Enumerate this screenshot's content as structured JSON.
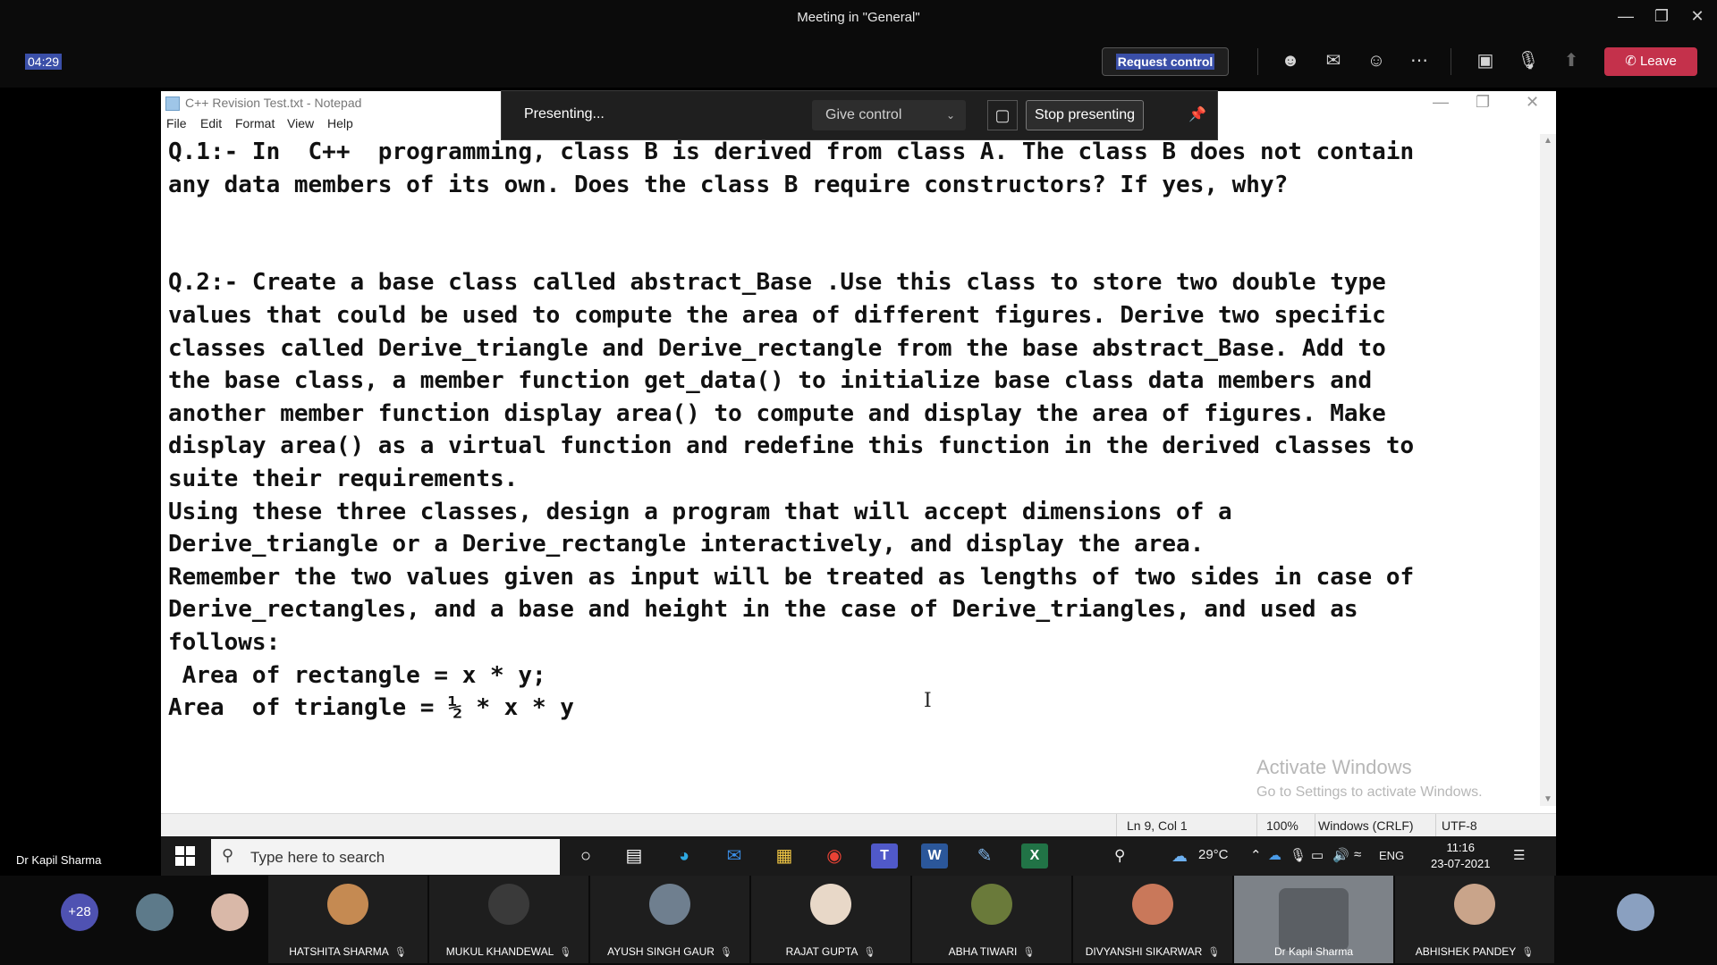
{
  "window": {
    "title": "Meeting in \"General\""
  },
  "toolbar": {
    "timer": "04:29",
    "request_control": "Request control",
    "leave": "Leave",
    "icons": [
      "people-icon",
      "chat-icon",
      "reactions-icon",
      "more-icon",
      "camera-off-icon",
      "mic-off-icon",
      "share-tray-icon"
    ]
  },
  "presenting_bar": {
    "status": "Presenting...",
    "give_control": "Give control",
    "stop_presenting": "Stop presenting"
  },
  "notepad": {
    "title": "C++ Revision Test.txt - Notepad",
    "menu": [
      "File",
      "Edit",
      "Format",
      "View",
      "Help"
    ],
    "text": "Q.1:- In  C++  programming, class B is derived from class A. The class B does not contain\nany data members of its own. Does the class B require constructors? If yes, why?\n\n\nQ.2:- Create a base class called abstract_Base .Use this class to store two double type\nvalues that could be used to compute the area of different figures. Derive two specific\nclasses called Derive_triangle and Derive_rectangle from the base abstract_Base. Add to\nthe base class, a member function get_data() to initialize base class data members and\nanother member function display area() to compute and display the area of figures. Make\ndisplay area() as a virtual function and redefine this function in the derived classes to\nsuite their requirements.\nUsing these three classes, design a program that will accept dimensions of a\nDerive_triangle or a Derive_rectangle interactively, and display the area.\nRemember the two values given as input will be treated as lengths of two sides in case of\nDerive_rectangles, and a base and height in the case of Derive_triangles, and used as\nfollows:\n Area of rectangle = x * y;\nArea  of triangle = ½ * x * y",
    "watermark_line1": "Activate Windows",
    "watermark_line2": "Go to Settings to activate Windows.",
    "status": {
      "position": "Ln 9, Col 1",
      "zoom": "100%",
      "line_ending": "Windows (CRLF)",
      "encoding": "UTF-8"
    }
  },
  "taskbar": {
    "search_placeholder": "Type here to search",
    "weather": "29°C",
    "language": "ENG",
    "time": "11:16",
    "date": "23-07-2021"
  },
  "presenter_name": "Dr Kapil Sharma",
  "participants": {
    "more_count": "+28",
    "tiles": [
      {
        "name": "HATSHITA SHARMA",
        "color": "#c58a52"
      },
      {
        "name": "MUKUL KHANDEWAL",
        "color": "#3a3a3a"
      },
      {
        "name": "AYUSH SINGH GAUR",
        "color": "#6f7f8f"
      },
      {
        "name": "RAJAT GUPTA",
        "color": "#e8d8c8"
      },
      {
        "name": "ABHA TIWARI",
        "color": "#6a7a3a"
      },
      {
        "name": "DIVYANSHI SIKARWAR",
        "color": "#c9785a"
      },
      {
        "name": "Dr Kapil Sharma",
        "color": "#8a8f96"
      },
      {
        "name": "ABHISHEK PANDEY",
        "color": "#c9a48a"
      }
    ]
  }
}
